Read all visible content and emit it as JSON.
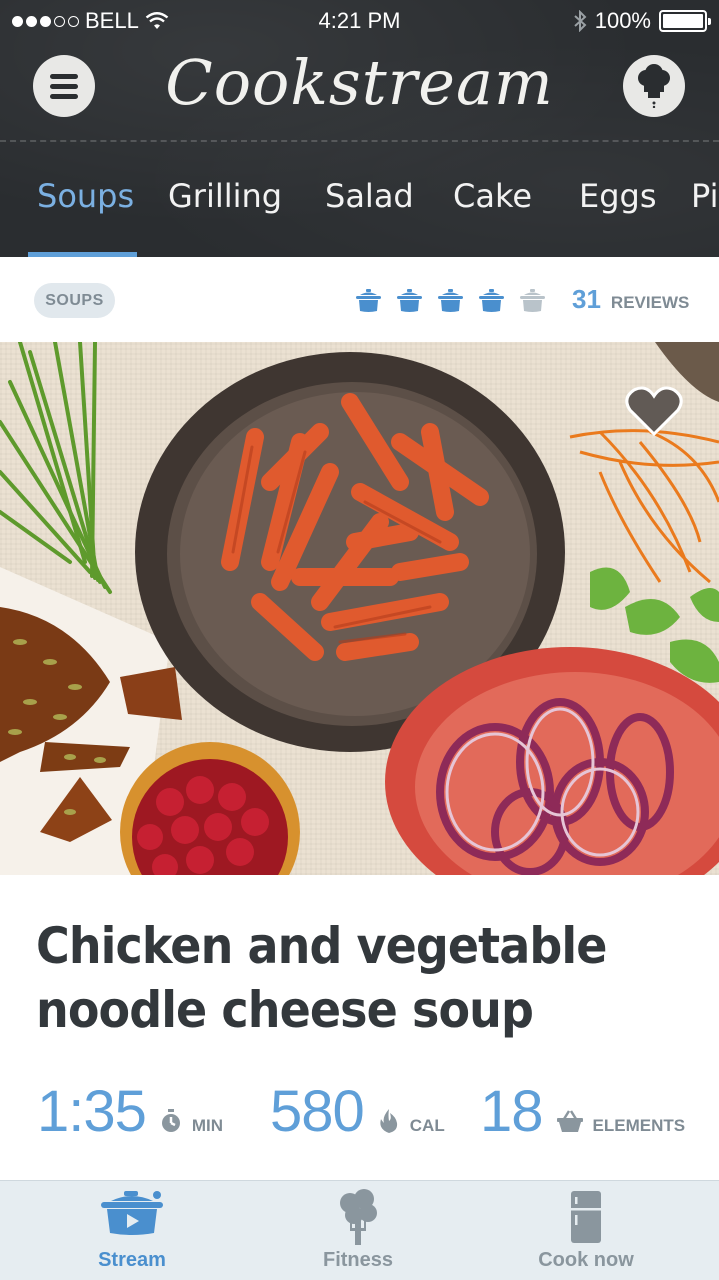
{
  "status_bar": {
    "carrier": "BELL",
    "time": "4:21 PM",
    "battery": "100%",
    "battery_level": 1.0,
    "signal_bars": 3,
    "signal_total": 5
  },
  "header": {
    "app_title": "Cookstream",
    "menu_icon": "hamburger-menu-icon",
    "profile_icon": "chef-hat-icon"
  },
  "tabs": {
    "items": [
      "Soups",
      "Grilling",
      "Salad",
      "Cake",
      "Eggs",
      "Pi"
    ],
    "active_index": 0
  },
  "recipe": {
    "category": "SOUPS",
    "rating": 4,
    "rating_max": 5,
    "reviews_count": "31",
    "reviews_label": "REVIEWS",
    "title_line1": "Chicken and vegetable",
    "title_line2": "noodle cheese soup",
    "time_value": "1:35",
    "time_label": "MIN",
    "calories_value": "580",
    "calories_label": "CAL",
    "elements_value": "18",
    "elements_label": "ELEMENTS"
  },
  "bottom_nav": {
    "items": [
      {
        "label": "Stream",
        "icon": "pot-play-icon"
      },
      {
        "label": "Fitness",
        "icon": "broccoli-fork-icon"
      },
      {
        "label": "Cook now",
        "icon": "fridge-icon"
      }
    ],
    "active_index": 0
  },
  "colors": {
    "accent": "#5f9fd8",
    "header_bg": "#2a2d30",
    "text_dark": "#33383c",
    "text_muted": "#7f8b94",
    "nav_bg": "#e6edf1"
  }
}
